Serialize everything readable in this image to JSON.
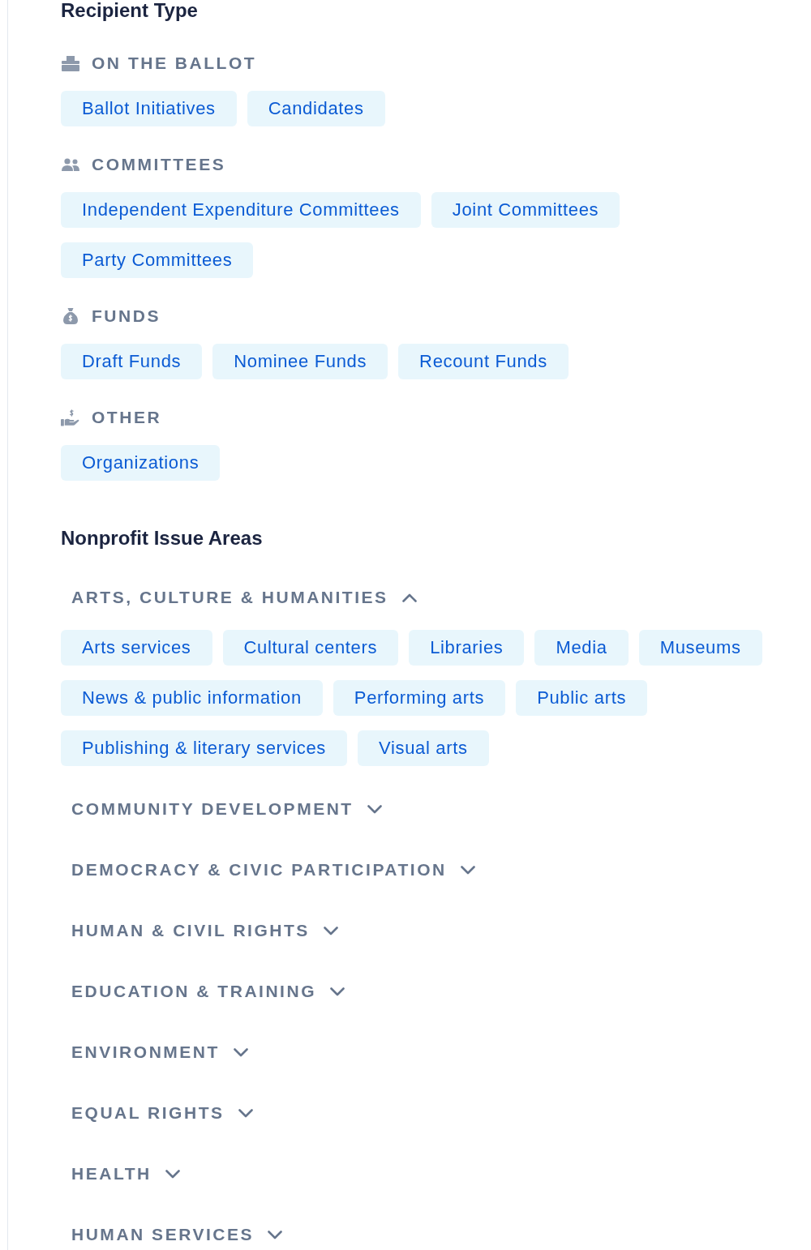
{
  "recipient_type": {
    "title": "Recipient Type",
    "groups": [
      {
        "label": "ON THE BALLOT",
        "options": [
          {
            "label": "Ballot Initiatives",
            "selected": false
          },
          {
            "label": "Candidates",
            "selected": false
          }
        ]
      },
      {
        "label": "COMMITTEES",
        "options": [
          {
            "label": "Independent Expenditure Committees",
            "selected": false
          },
          {
            "label": "Joint Committees",
            "selected": false
          },
          {
            "label": "Party Committees",
            "selected": false
          }
        ]
      },
      {
        "label": "FUNDS",
        "options": [
          {
            "label": "Draft Funds",
            "selected": false
          },
          {
            "label": "Nominee Funds",
            "selected": false
          },
          {
            "label": "Recount Funds",
            "selected": false
          }
        ]
      },
      {
        "label": "OTHER",
        "options": [
          {
            "label": "Organizations",
            "selected": false
          }
        ]
      }
    ]
  },
  "issue_areas": {
    "title": "Nonprofit Issue Areas",
    "categories": [
      {
        "label": "ARTS, CULTURE & HUMANITIES",
        "expanded": true,
        "options": [
          {
            "label": "Arts services",
            "selected": false
          },
          {
            "label": "Cultural centers",
            "selected": false
          },
          {
            "label": "Libraries",
            "selected": false
          },
          {
            "label": "Media",
            "selected": false
          },
          {
            "label": "Museums",
            "selected": false
          },
          {
            "label": "News & public information",
            "selected": false
          },
          {
            "label": "Performing arts",
            "selected": false
          },
          {
            "label": "Public arts",
            "selected": false
          },
          {
            "label": "Publishing & literary services",
            "selected": false
          },
          {
            "label": "Visual arts",
            "selected": false
          }
        ]
      },
      {
        "label": "COMMUNITY DEVELOPMENT",
        "expanded": false
      },
      {
        "label": "DEMOCRACY & CIVIC PARTICIPATION",
        "expanded": false
      },
      {
        "label": "HUMAN & CIVIL RIGHTS",
        "expanded": false
      },
      {
        "label": "EDUCATION & TRAINING",
        "expanded": false
      },
      {
        "label": "ENVIRONMENT",
        "expanded": false
      },
      {
        "label": "EQUAL RIGHTS",
        "expanded": false
      },
      {
        "label": "HEALTH",
        "expanded": false
      },
      {
        "label": "HUMAN SERVICES",
        "expanded": false
      }
    ]
  }
}
